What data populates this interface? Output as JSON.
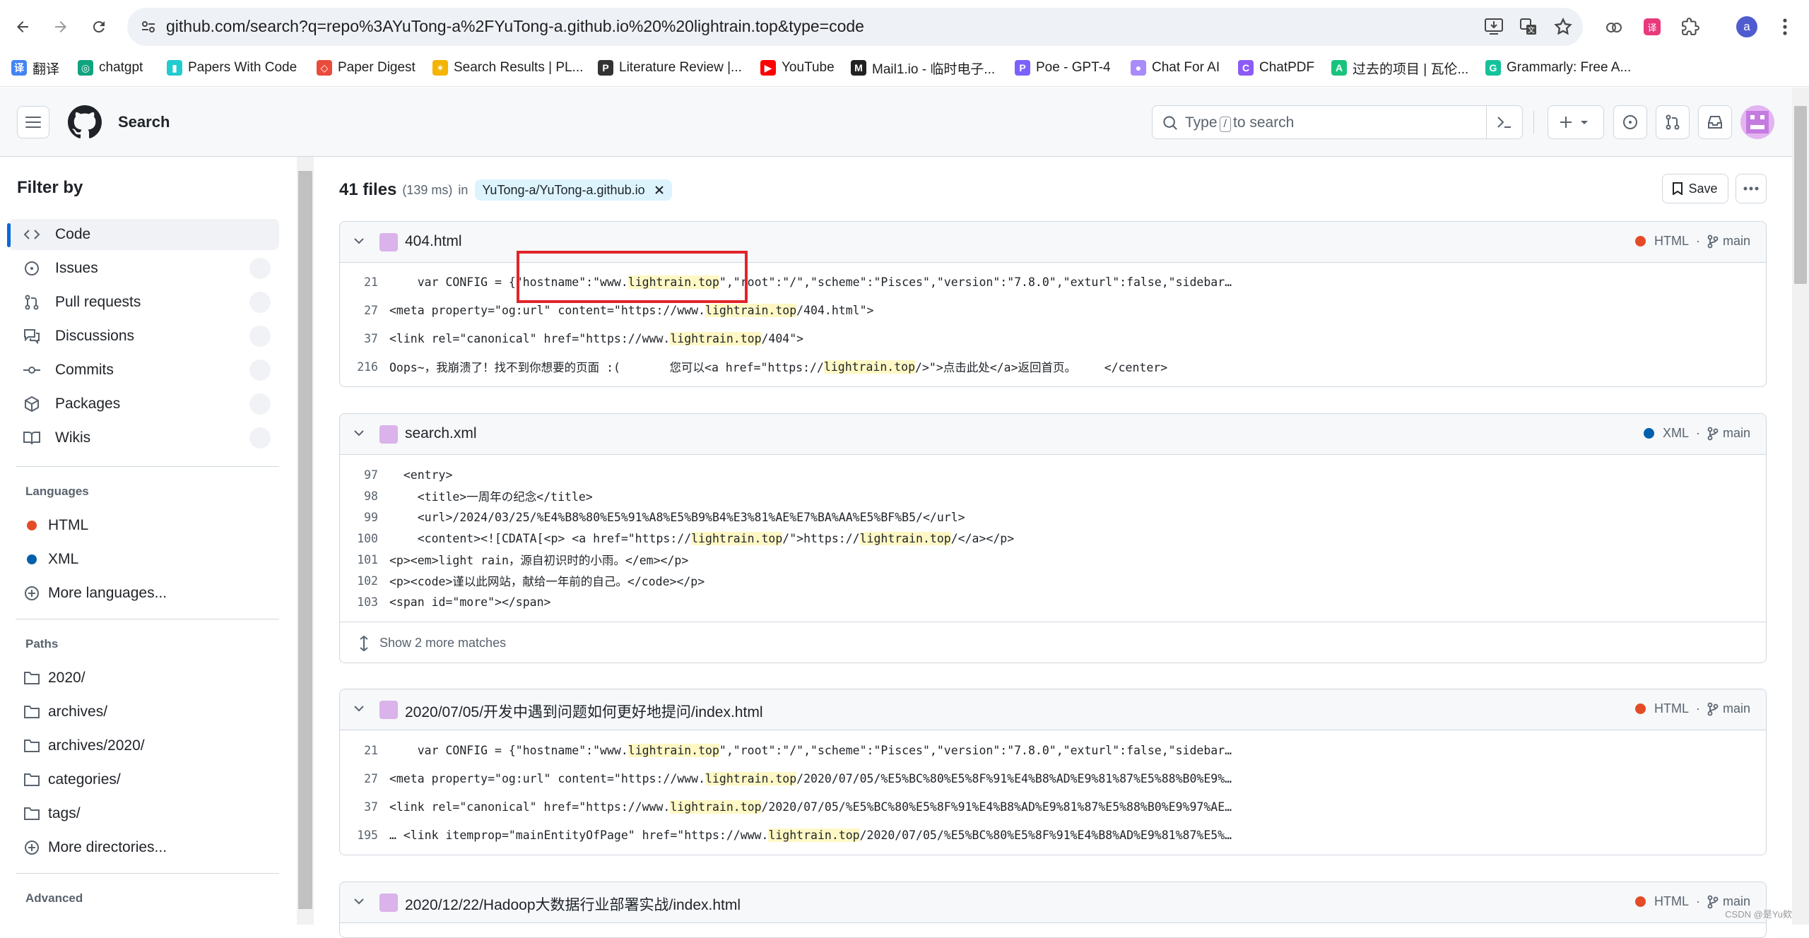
{
  "browser": {
    "url": "github.com/search?q=repo%3AYuTong-a%2FYuTong-a.github.io%20%20lightrain.top&type=code",
    "profile_initial": "a",
    "bookmarks": [
      {
        "label": "翻译",
        "color": "#4285f4"
      },
      {
        "label": "chatgpt",
        "color": "#10a37f"
      },
      {
        "label": "Papers With Code",
        "color": "#21cbce"
      },
      {
        "label": "Paper Digest",
        "color": "#e94b3c"
      },
      {
        "label": "Search Results | PL...",
        "color": "#f4b400"
      },
      {
        "label": "Literature Review |...",
        "color": "#333333"
      },
      {
        "label": "YouTube",
        "color": "#ff0000"
      },
      {
        "label": "Mail1.io - 临时电子...",
        "color": "#222222"
      },
      {
        "label": "Poe - GPT-4",
        "color": "#7b61ff"
      },
      {
        "label": "Chat For AI",
        "color": "#a78bfa"
      },
      {
        "label": "ChatPDF",
        "color": "#8b5cf6"
      },
      {
        "label": "过去的项目 | 瓦伦...",
        "color": "#19c37d"
      },
      {
        "label": "Grammarly: Free A...",
        "color": "#15c39a"
      }
    ]
  },
  "header": {
    "title": "Search",
    "search_placeholder_before": "Type",
    "search_key": "/",
    "search_placeholder_after": "to search"
  },
  "sidebar": {
    "title": "Filter by",
    "types": [
      {
        "label": "Code",
        "icon": "code-icon"
      },
      {
        "label": "Issues",
        "icon": "issue-icon"
      },
      {
        "label": "Pull requests",
        "icon": "pull-request-icon"
      },
      {
        "label": "Discussions",
        "icon": "discussion-icon"
      },
      {
        "label": "Commits",
        "icon": "commit-icon"
      },
      {
        "label": "Packages",
        "icon": "package-icon"
      },
      {
        "label": "Wikis",
        "icon": "book-icon"
      }
    ],
    "languages_title": "Languages",
    "languages": [
      {
        "label": "HTML",
        "color": "#e34c26"
      },
      {
        "label": "XML",
        "color": "#0060ac"
      }
    ],
    "more_languages": "More languages...",
    "paths_title": "Paths",
    "paths": [
      "2020/",
      "archives/",
      "archives/2020/",
      "categories/",
      "tags/"
    ],
    "more_directories": "More directories...",
    "advanced_title": "Advanced"
  },
  "results": {
    "count": "41 files",
    "time": "(139 ms)",
    "in_label": "in",
    "repo": "YuTong-a/YuTong-a.github.io",
    "save_label": "Save",
    "show_more": "Show 2 more matches",
    "branch": "main",
    "files": [
      {
        "name": "404.html",
        "lang": "HTML",
        "lang_color": "#e34c26"
      },
      {
        "name": "search.xml",
        "lang": "XML",
        "lang_color": "#0060ac"
      },
      {
        "name": "2020/07/05/开发中遇到问题如何更好地提问/index.html",
        "lang": "HTML",
        "lang_color": "#e34c26"
      },
      {
        "name": "2020/12/22/Hadoop大数据行业部署实战/index.html",
        "lang": "HTML",
        "lang_color": "#e34c26"
      }
    ],
    "r1_lines": [
      {
        "n": "21",
        "a": "    var CONFIG = {\"hostname\":\"www.",
        "h": "lightrain.top",
        "b": "\",\"root\":\"/\",\"scheme\":\"Pisces\",\"version\":\"7.8.0\",\"exturl\":false,\"sidebar…"
      },
      {
        "n": "27",
        "a": "<meta property=\"og:url\" content=\"https://www.",
        "h": "lightrain.top",
        "b": "/404.html\">"
      },
      {
        "n": "37",
        "a": "<link rel=\"canonical\" href=\"https://www.",
        "h": "lightrain.top",
        "b": "/404\">"
      },
      {
        "n": "216",
        "a": "Oops~，我崩溃了！找不到你想要的页面 :(       您可以<a href=\"https://",
        "h": "lightrain.top",
        "b": "/>\">点击此处</a>返回首页。    </center>"
      }
    ],
    "r2_lines": [
      {
        "n": "97",
        "a": "  <entry>",
        "h": "",
        "b": ""
      },
      {
        "n": "98",
        "a": "    <title>一周年の纪念</title>",
        "h": "",
        "b": ""
      },
      {
        "n": "99",
        "a": "    <url>/2024/03/25/%E4%B8%80%E5%91%A8%E5%B9%B4%E3%81%AE%E7%BA%AA%E5%BF%B5/</url>",
        "h": "",
        "b": ""
      },
      {
        "n": "100",
        "a": "    <content><![CDATA[<p> <a href=\"https://",
        "h": "lightrain.top",
        "b": "/\">https://",
        "h2": "lightrain.top",
        "b2": "/</a></p>"
      },
      {
        "n": "101",
        "a": "<p><em>light rain，源自初识时的小雨。</em></p>",
        "h": "",
        "b": ""
      },
      {
        "n": "102",
        "a": "<p><code>谨以此网站，献给一年前的自己。</code></p>",
        "h": "",
        "b": ""
      },
      {
        "n": "103",
        "a": "<span id=\"more\"></span>",
        "h": "",
        "b": ""
      }
    ],
    "r3_lines": [
      {
        "n": "21",
        "a": "    var CONFIG = {\"hostname\":\"www.",
        "h": "lightrain.top",
        "b": "\",\"root\":\"/\",\"scheme\":\"Pisces\",\"version\":\"7.8.0\",\"exturl\":false,\"sidebar…"
      },
      {
        "n": "27",
        "a": "<meta property=\"og:url\" content=\"https://www.",
        "h": "lightrain.top",
        "b": "/2020/07/05/%E5%BC%80%E5%8F%91%E4%B8%AD%E9%81%87%E5%88%B0%E9%…"
      },
      {
        "n": "37",
        "a": "<link rel=\"canonical\" href=\"https://www.",
        "h": "lightrain.top",
        "b": "/2020/07/05/%E5%BC%80%E5%8F%91%E4%B8%AD%E9%81%87%E5%88%B0%E9%97%AE…"
      },
      {
        "n": "195",
        "a": "… <link itemprop=\"mainEntityOfPage\" href=\"https://www.",
        "h": "lightrain.top",
        "b": "/2020/07/05/%E5%BC%80%E5%8F%91%E4%B8%AD%E9%81%87%E5%…"
      }
    ]
  },
  "watermark": "CSDN @是Yu欸"
}
